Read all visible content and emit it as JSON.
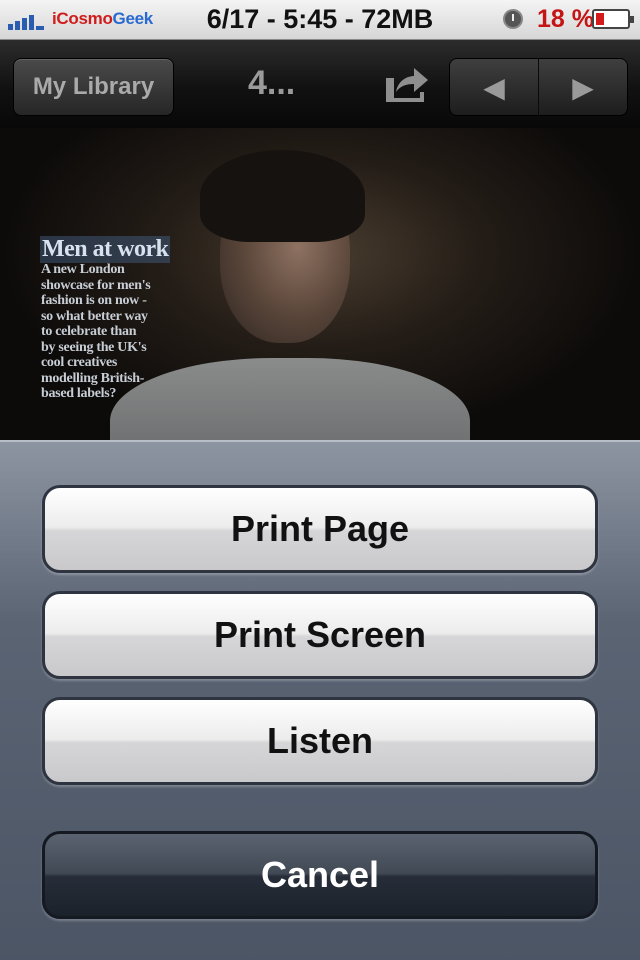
{
  "status_bar": {
    "carrier_prefix": "iCosmo",
    "carrier_suffix": "Geek",
    "center_text": "6/17 - 5:45 - 72MB",
    "battery_percent": "18 %",
    "icons": [
      "signal-bars-icon",
      "alarm-clock-icon",
      "battery-icon"
    ],
    "battery_color": "#d41a1a"
  },
  "nav_bar": {
    "library_button": "My Library",
    "title": "4...",
    "icons": [
      "share-icon",
      "previous-arrow-icon",
      "next-arrow-icon"
    ]
  },
  "article": {
    "headline": "Men at work",
    "body_lines": [
      "A new London",
      "showcase for men's",
      "fashion is on now -",
      "so what better way",
      "to celebrate than",
      "by seeing the UK's",
      "cool creatives",
      "modelling British-",
      "based labels?"
    ]
  },
  "action_sheet": {
    "buttons": [
      {
        "label": "Print Page"
      },
      {
        "label": "Print Screen"
      },
      {
        "label": "Listen"
      }
    ],
    "cancel_label": "Cancel"
  }
}
